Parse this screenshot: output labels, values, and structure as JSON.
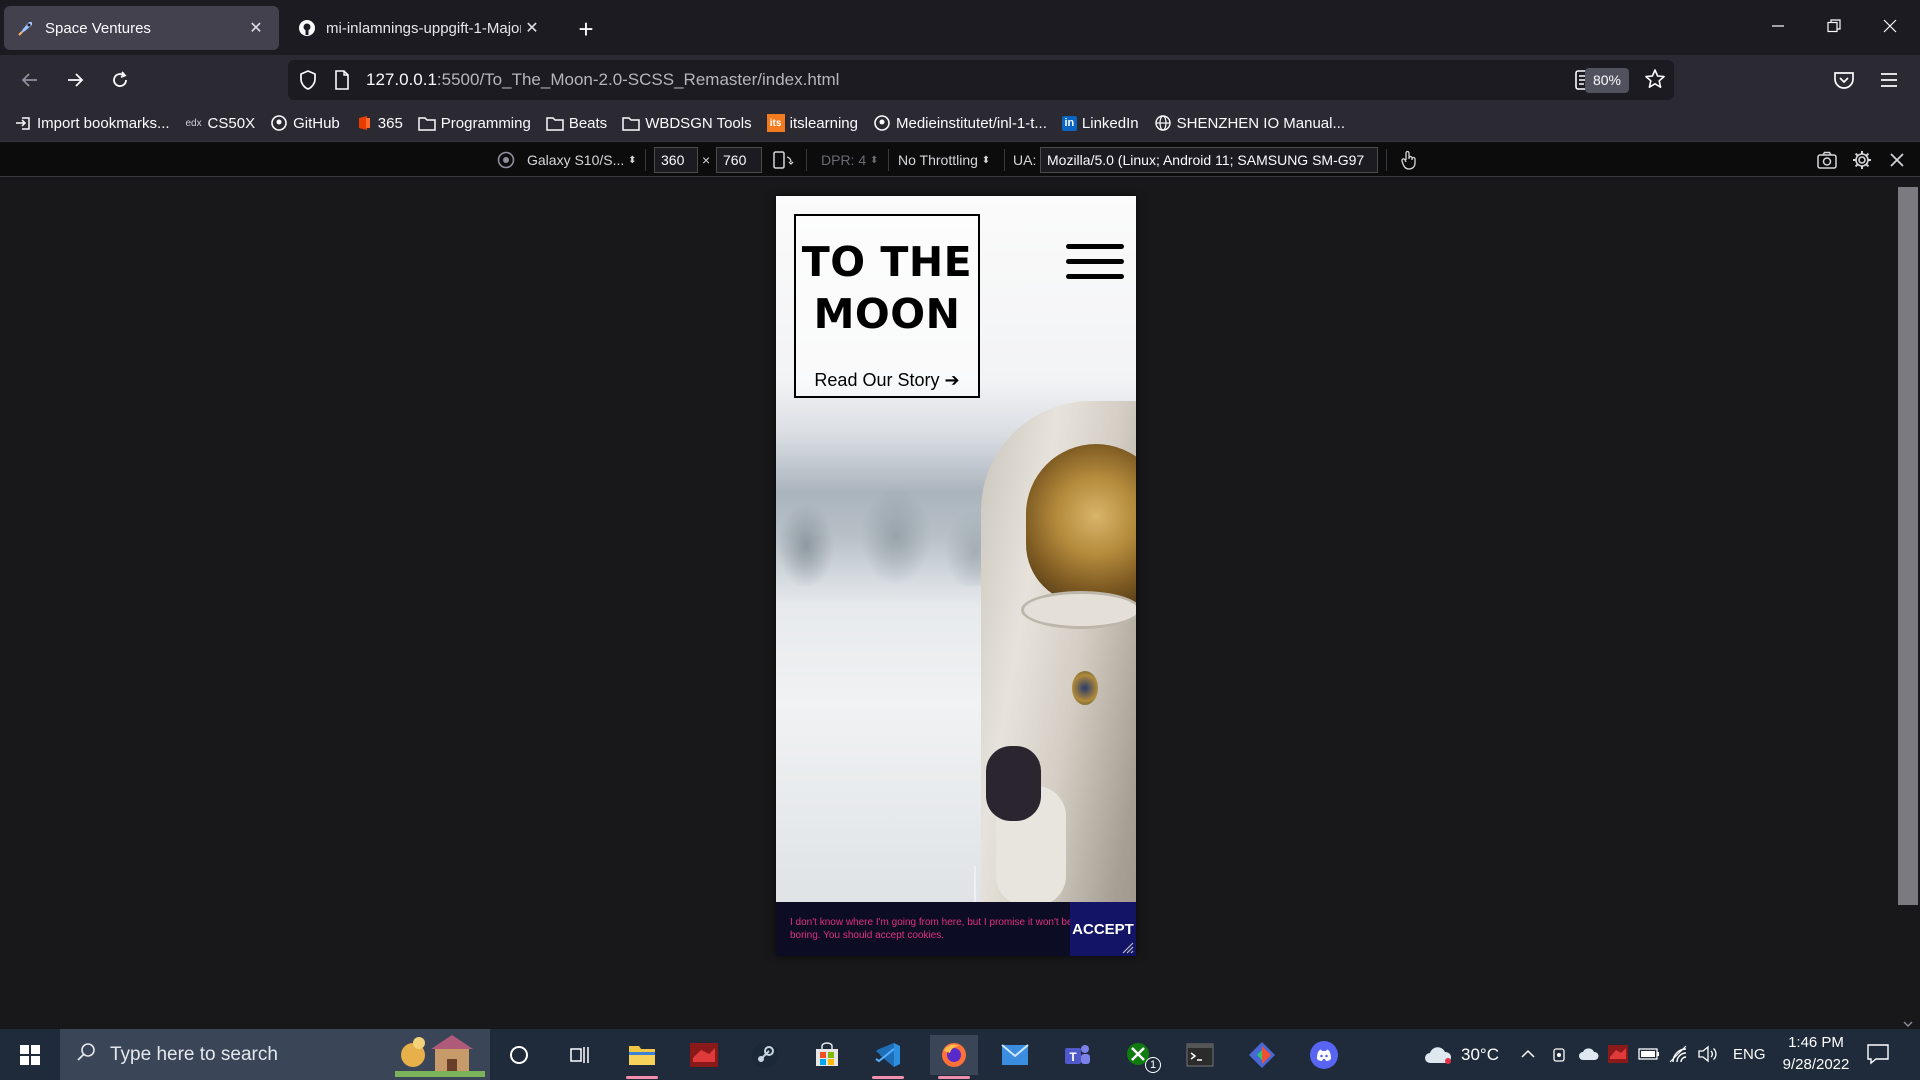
{
  "browser": {
    "tabs": [
      {
        "title": "Space Ventures",
        "active": true,
        "favicon": "rocket-icon"
      },
      {
        "title": "mi-inlamnings-uppgift-1-Major",
        "active": false,
        "favicon": "github-icon"
      }
    ],
    "url_host": "127.0.0.1",
    "url_rest": ":5500/To_The_Moon-2.0-SCSS_Remaster/index.html",
    "zoom": "80%",
    "bookmarks": [
      {
        "label": "Import bookmarks...",
        "icon": "import-icon"
      },
      {
        "label": "CS50X",
        "icon": "edx-icon"
      },
      {
        "label": "GitHub",
        "icon": "github-icon"
      },
      {
        "label": "365",
        "icon": "office-icon"
      },
      {
        "label": "Programming",
        "icon": "folder-icon"
      },
      {
        "label": "Beats",
        "icon": "folder-icon"
      },
      {
        "label": "WBDSGN Tools",
        "icon": "folder-icon"
      },
      {
        "label": "itslearning",
        "icon": "itslearning-icon"
      },
      {
        "label": "Medieinstitutet/inl-1-t...",
        "icon": "github-icon"
      },
      {
        "label": "LinkedIn",
        "icon": "linkedin-icon"
      },
      {
        "label": "SHENZHEN IO Manual...",
        "icon": "globe-icon"
      }
    ],
    "rdm": {
      "device": "Galaxy S10/S...",
      "width": "360",
      "times": "×",
      "height": "760",
      "dpr": "DPR: 4",
      "throttling": "No Throttling",
      "ua_label": "UA:",
      "ua_value": "Mozilla/5.0 (Linux; Android 11; SAMSUNG SM-G97"
    }
  },
  "page": {
    "title": "TO THE MOON",
    "title_line1": "TO THE",
    "title_line2": "MOON",
    "story_link": "Read Our Story ➔",
    "cookie_text": "I don't know where I'm going from here, but I promise it won't be boring. You should accept cookies.",
    "accept_label": "ACCEPT",
    "colors": {
      "cookie_bg": "#0d0c25",
      "cookie_text": "#e0317f",
      "accept_bg": "#141466"
    }
  },
  "taskbar": {
    "search_placeholder": "Type here to search",
    "weather": "30°C",
    "language": "ENG",
    "time": "1:46 PM",
    "date": "9/28/2022",
    "xbox_badge": "1"
  }
}
